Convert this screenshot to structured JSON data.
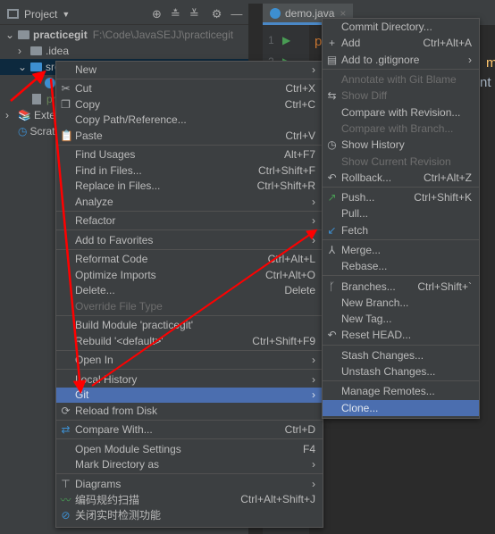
{
  "toolwindow": {
    "title": "Project",
    "icons": [
      "locate-icon",
      "expand-all-icon",
      "collapse-all-icon",
      "gear-icon",
      "minimize-icon"
    ],
    "tree": [
      {
        "label": "practicegit",
        "path": "F:\\Code\\JavaSEJJ\\practicegit"
      },
      {
        "label": ".idea"
      },
      {
        "label": "src"
      },
      {
        "label": ""
      },
      {
        "label": "pr"
      },
      {
        "label": "Exter"
      },
      {
        "label": "Scrat"
      }
    ]
  },
  "editor": {
    "tab": "demo.java",
    "lines": [
      "1",
      "2"
    ],
    "code_fragments": [
      "p",
      "m",
      "nt"
    ]
  },
  "context_menu": {
    "items": [
      {
        "label": "New",
        "submenu": true
      },
      {
        "label": "Cut",
        "shortcut": "Ctrl+X",
        "icon": "scissors-icon"
      },
      {
        "label": "Copy",
        "shortcut": "Ctrl+C",
        "icon": "copy-icon"
      },
      {
        "label": "Copy Path/Reference..."
      },
      {
        "label": "Paste",
        "shortcut": "Ctrl+V",
        "icon": "clipboard-icon"
      },
      {
        "label": "Find Usages",
        "shortcut": "Alt+F7"
      },
      {
        "label": "Find in Files...",
        "shortcut": "Ctrl+Shift+F"
      },
      {
        "label": "Replace in Files...",
        "shortcut": "Ctrl+Shift+R"
      },
      {
        "label": "Analyze",
        "submenu": true
      },
      {
        "label": "Refactor",
        "submenu": true
      },
      {
        "label": "Add to Favorites",
        "submenu": true
      },
      {
        "label": "Reformat Code",
        "shortcut": "Ctrl+Alt+L"
      },
      {
        "label": "Optimize Imports",
        "shortcut": "Ctrl+Alt+O"
      },
      {
        "label": "Delete...",
        "shortcut": "Delete"
      },
      {
        "label": "Override File Type",
        "disabled": true
      },
      {
        "label": "Build Module 'practicegit'"
      },
      {
        "label": "Rebuild '<default>'",
        "shortcut": "Ctrl+Shift+F9"
      },
      {
        "label": "Open In",
        "submenu": true
      },
      {
        "label": "Local History",
        "submenu": true
      },
      {
        "label": "Git",
        "submenu": true,
        "highlighted": true
      },
      {
        "label": "Reload from Disk",
        "icon": "reload-icon"
      },
      {
        "label": "Compare With...",
        "shortcut": "Ctrl+D",
        "icon": "compare-icon"
      },
      {
        "label": "Open Module Settings",
        "shortcut": "F4"
      },
      {
        "label": "Mark Directory as",
        "submenu": true
      },
      {
        "label": "Diagrams",
        "submenu": true,
        "icon": "diagram-icon"
      },
      {
        "label": "编码规约扫描",
        "shortcut": "Ctrl+Alt+Shift+J",
        "icon": "scan-icon"
      },
      {
        "label": "关闭实时检测功能",
        "icon": "prohibit-icon"
      }
    ],
    "separators_after": [
      0,
      4,
      8,
      9,
      10,
      14,
      16,
      17,
      20,
      21,
      23
    ]
  },
  "git_menu": {
    "items": [
      {
        "label": "Commit Directory..."
      },
      {
        "label": "Add",
        "shortcut": "Ctrl+Alt+A",
        "icon": "plus-icon"
      },
      {
        "label": "Add to .gitignore",
        "submenu": true,
        "icon": "gitignore-icon"
      },
      {
        "label": "Annotate with Git Blame",
        "disabled": true
      },
      {
        "label": "Show Diff",
        "disabled": true,
        "icon": "diff-icon"
      },
      {
        "label": "Compare with Revision..."
      },
      {
        "label": "Compare with Branch...",
        "disabled": true
      },
      {
        "label": "Show History",
        "icon": "clock-icon"
      },
      {
        "label": "Show Current Revision",
        "disabled": true
      },
      {
        "label": "Rollback...",
        "shortcut": "Ctrl+Alt+Z",
        "icon": "undo-icon"
      },
      {
        "label": "Push...",
        "shortcut": "Ctrl+Shift+K",
        "icon": "push-arrow-icon"
      },
      {
        "label": "Pull..."
      },
      {
        "label": "Fetch",
        "icon": "fetch-arrow-icon"
      },
      {
        "label": "Merge...",
        "icon": "merge-icon"
      },
      {
        "label": "Rebase..."
      },
      {
        "label": "Branches...",
        "shortcut": "Ctrl+Shift+`",
        "icon": "branch-icon"
      },
      {
        "label": "New Branch..."
      },
      {
        "label": "New Tag..."
      },
      {
        "label": "Reset HEAD...",
        "icon": "undo-icon"
      },
      {
        "label": "Stash Changes..."
      },
      {
        "label": "Unstash Changes..."
      },
      {
        "label": "Manage Remotes..."
      },
      {
        "label": "Clone...",
        "highlighted": true
      }
    ],
    "separators_after": [
      2,
      9,
      12,
      14,
      18,
      20
    ]
  },
  "colors": {
    "highlight": "#4b6eaf",
    "annotation_arrows": "#ff0000",
    "menu_bg": "#3c3f41"
  }
}
